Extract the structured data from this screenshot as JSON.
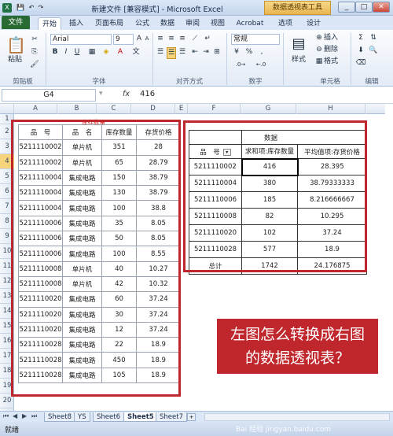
{
  "window": {
    "title": "新建文件 [兼容模式] - Microsoft Excel",
    "tools_tab": "数据透视表工具"
  },
  "tabs": {
    "file": "文件",
    "items": [
      "开始",
      "插入",
      "页面布局",
      "公式",
      "数据",
      "审阅",
      "视图",
      "Acrobat",
      "选项",
      "设计"
    ]
  },
  "ribbon": {
    "paste": "粘贴",
    "clipboard": "剪贴板",
    "font_name": "Arial",
    "font_size": "9",
    "font_group": "字体",
    "align_group": "对齐方式",
    "number_format": "常规",
    "number_group": "数字",
    "styles": "样式",
    "insert": "插入",
    "delete": "删除",
    "format": "格式",
    "cells_group": "单元格",
    "edit_group": "编辑"
  },
  "formula_bar": {
    "cell": "G4",
    "fx": "fx",
    "value": "416"
  },
  "columns": [
    "A",
    "B",
    "C",
    "D",
    "E",
    "F",
    "G",
    "H"
  ],
  "rows": [
    "1",
    "2",
    "3",
    "4",
    "5",
    "6",
    "7",
    "8",
    "9",
    "10",
    "11",
    "12",
    "13",
    "14",
    "15",
    "16",
    "17",
    "18",
    "19",
    "20",
    "21",
    "22",
    "23"
  ],
  "left_table": {
    "annotation": "库存数量",
    "headers": [
      "品　号",
      "品　名",
      "库存数量",
      "存货价格"
    ],
    "rows": [
      [
        "5211110002",
        "单片机",
        "351",
        "28"
      ],
      [
        "5211110002",
        "单片机",
        "65",
        "28.79"
      ],
      [
        "5211110004",
        "集成电路",
        "150",
        "38.79"
      ],
      [
        "5211110004",
        "集成电路",
        "130",
        "38.79"
      ],
      [
        "5211110004",
        "集成电路",
        "100",
        "38.8"
      ],
      [
        "5211110006",
        "集成电路",
        "35",
        "8.05"
      ],
      [
        "5211110006",
        "集成电路",
        "50",
        "8.05"
      ],
      [
        "5211110006",
        "集成电路",
        "100",
        "8.55"
      ],
      [
        "5211110008",
        "单片机",
        "40",
        "10.27"
      ],
      [
        "5211110008",
        "单片机",
        "42",
        "10.32"
      ],
      [
        "5211110020",
        "集成电路",
        "60",
        "37.24"
      ],
      [
        "5211110020",
        "集成电路",
        "30",
        "37.24"
      ],
      [
        "5211110020",
        "集成电路",
        "12",
        "37.24"
      ],
      [
        "5211110028",
        "集成电路",
        "22",
        "18.9"
      ],
      [
        "5211110028",
        "集成电路",
        "450",
        "18.9"
      ],
      [
        "5211110028",
        "集成电路",
        "105",
        "18.9"
      ]
    ]
  },
  "pivot": {
    "data_label": "数据",
    "row_label": "品　号",
    "col1": "求和项:库存数量",
    "col2": "平均值项:存货价格",
    "rows": [
      [
        "5211110002",
        "416",
        "28.395"
      ],
      [
        "5211110004",
        "380",
        "38.79333333"
      ],
      [
        "5211110006",
        "185",
        "8.216666667"
      ],
      [
        "5211110008",
        "82",
        "10.295"
      ],
      [
        "5211110020",
        "102",
        "37.24"
      ],
      [
        "5211110028",
        "577",
        "18.9"
      ]
    ],
    "total_label": "总计",
    "total_sum": "1742",
    "total_avg": "24.176875"
  },
  "callout": "左图怎么转换成右图的数据透视表？",
  "sheets": [
    "Sheet8",
    "YS",
    "Sheet6",
    "Sheet5",
    "Sheet7"
  ],
  "status": "就绪",
  "watermark": "Bai 经验 jingyan.baidu.com"
}
